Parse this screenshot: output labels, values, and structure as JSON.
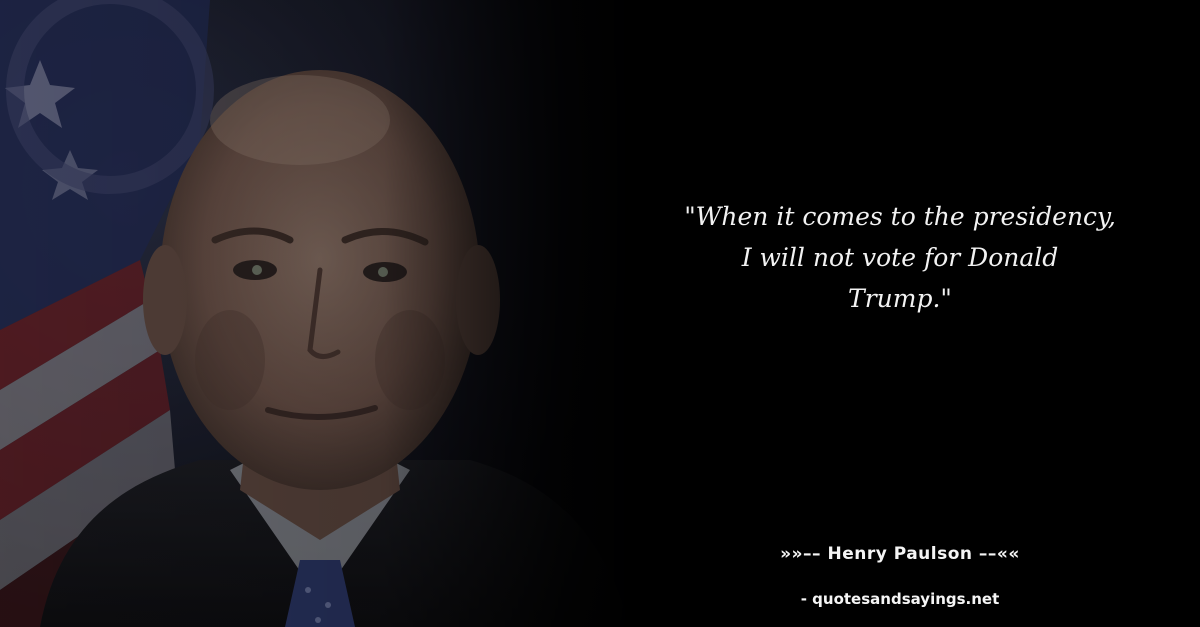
{
  "quote": {
    "lines": [
      "\"When it comes to the presidency,",
      "I will not vote for Donald",
      "Trump.\""
    ]
  },
  "author": {
    "label": "»»–– Henry Paulson ––««"
  },
  "source": {
    "label": "- quotesandsayings.net"
  },
  "colors": {
    "background": "#000000",
    "text": "#f2f2f2"
  }
}
